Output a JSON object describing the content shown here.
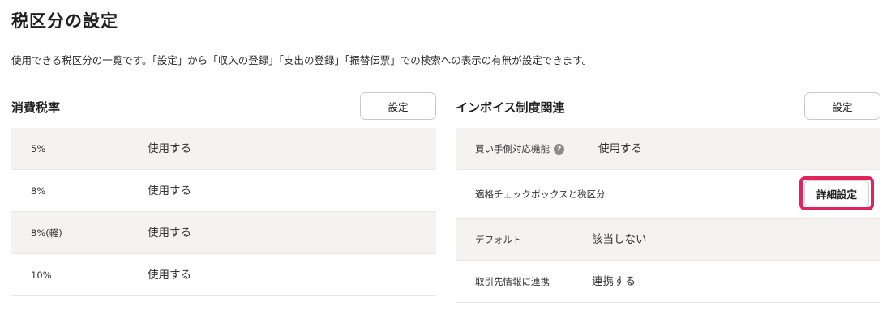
{
  "page": {
    "title": "税区分の設定",
    "description": "使用できる税区分の一覧です。「設定」から「収入の登録」「支出の登録」「振替伝票」での検索への表示の有無が設定できます。"
  },
  "consumption_tax": {
    "title": "消費税率",
    "settings_button": "設定",
    "rows": [
      {
        "rate": "5%",
        "status": "使用する"
      },
      {
        "rate": "8%",
        "status": "使用する"
      },
      {
        "rate": "8%(軽)",
        "status": "使用する"
      },
      {
        "rate": "10%",
        "status": "使用する"
      }
    ]
  },
  "invoice": {
    "title": "インボイス制度関連",
    "settings_button": "設定",
    "buyer_feature": {
      "label": "買い手側対応機能",
      "help_icon": "?",
      "value": "使用する"
    },
    "checkbox_section": {
      "label": "適格チェックボックスと税区分",
      "detail_button": "詳細設定"
    },
    "default": {
      "label": "デフォルト",
      "value": "該当しない"
    },
    "partner_link": {
      "label": "取引先情報に連携",
      "value": "連携する"
    }
  },
  "colors": {
    "highlight": "#e0245e",
    "row_shade": "#f5f2f2"
  }
}
